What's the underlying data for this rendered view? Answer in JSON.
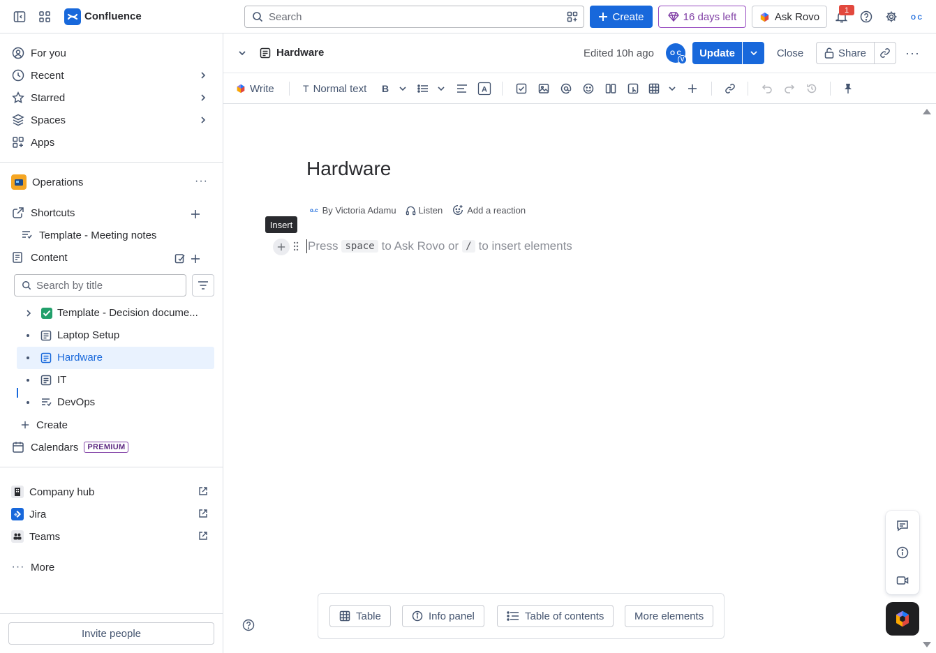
{
  "app": {
    "name": "Confluence"
  },
  "topbar": {
    "search_placeholder": "Search",
    "create_label": "Create",
    "trial_label": "16 days left",
    "rovo_label": "Ask Rovo",
    "notification_count": "1",
    "avatar_initials": "O C"
  },
  "sidebar": {
    "nav": [
      {
        "label": "For you",
        "icon": "user-circle-icon"
      },
      {
        "label": "Recent",
        "icon": "clock-icon"
      },
      {
        "label": "Starred",
        "icon": "star-icon"
      },
      {
        "label": "Spaces",
        "icon": "spaces-icon"
      },
      {
        "label": "Apps",
        "icon": "apps-icon"
      }
    ],
    "space_name": "Operations",
    "shortcuts_label": "Shortcuts",
    "shortcut_item": "Template - Meeting notes",
    "content_label": "Content",
    "search_placeholder": "Search by title",
    "tree": [
      {
        "label": "Template - Decision docume...",
        "icon": "check-box-icon"
      },
      {
        "label": "Laptop Setup",
        "icon": "page-icon"
      },
      {
        "label": "Hardware",
        "icon": "page-icon",
        "selected": true
      },
      {
        "label": "IT",
        "icon": "page-icon"
      },
      {
        "label": "DevOps",
        "icon": "live-doc-icon"
      }
    ],
    "create_label": "Create",
    "calendars_label": "Calendars",
    "premium_badge": "PREMIUM",
    "apps_links": [
      {
        "label": "Company hub",
        "icon": "company-hub-icon"
      },
      {
        "label": "Jira",
        "icon": "jira-icon"
      },
      {
        "label": "Teams",
        "icon": "teams-icon"
      }
    ],
    "more_label": "More",
    "invite_label": "Invite people"
  },
  "page_header": {
    "title": "Hardware",
    "edited": "Edited 10h ago",
    "avatar_initials": "O C",
    "avatar_badge": "V",
    "update_label": "Update",
    "close_label": "Close",
    "share_label": "Share"
  },
  "toolbar": {
    "write_label": "Write",
    "text_style": "Normal text"
  },
  "editor": {
    "title": "Hardware",
    "byline_author": "By Victoria Adamu",
    "listen_label": "Listen",
    "reaction_label": "Add a reaction",
    "tooltip": "Insert",
    "placeholder_a": "Press",
    "placeholder_key1": "space",
    "placeholder_b": "to Ask Rovo or",
    "placeholder_key2": "/",
    "placeholder_c": "to insert elements"
  },
  "elements_bar": {
    "table": "Table",
    "info_panel": "Info panel",
    "toc": "Table of contents",
    "more": "More elements"
  },
  "colors": {
    "accent": "#1868db",
    "trial": "#803fa5",
    "selected_bg": "#e9f2fe"
  }
}
